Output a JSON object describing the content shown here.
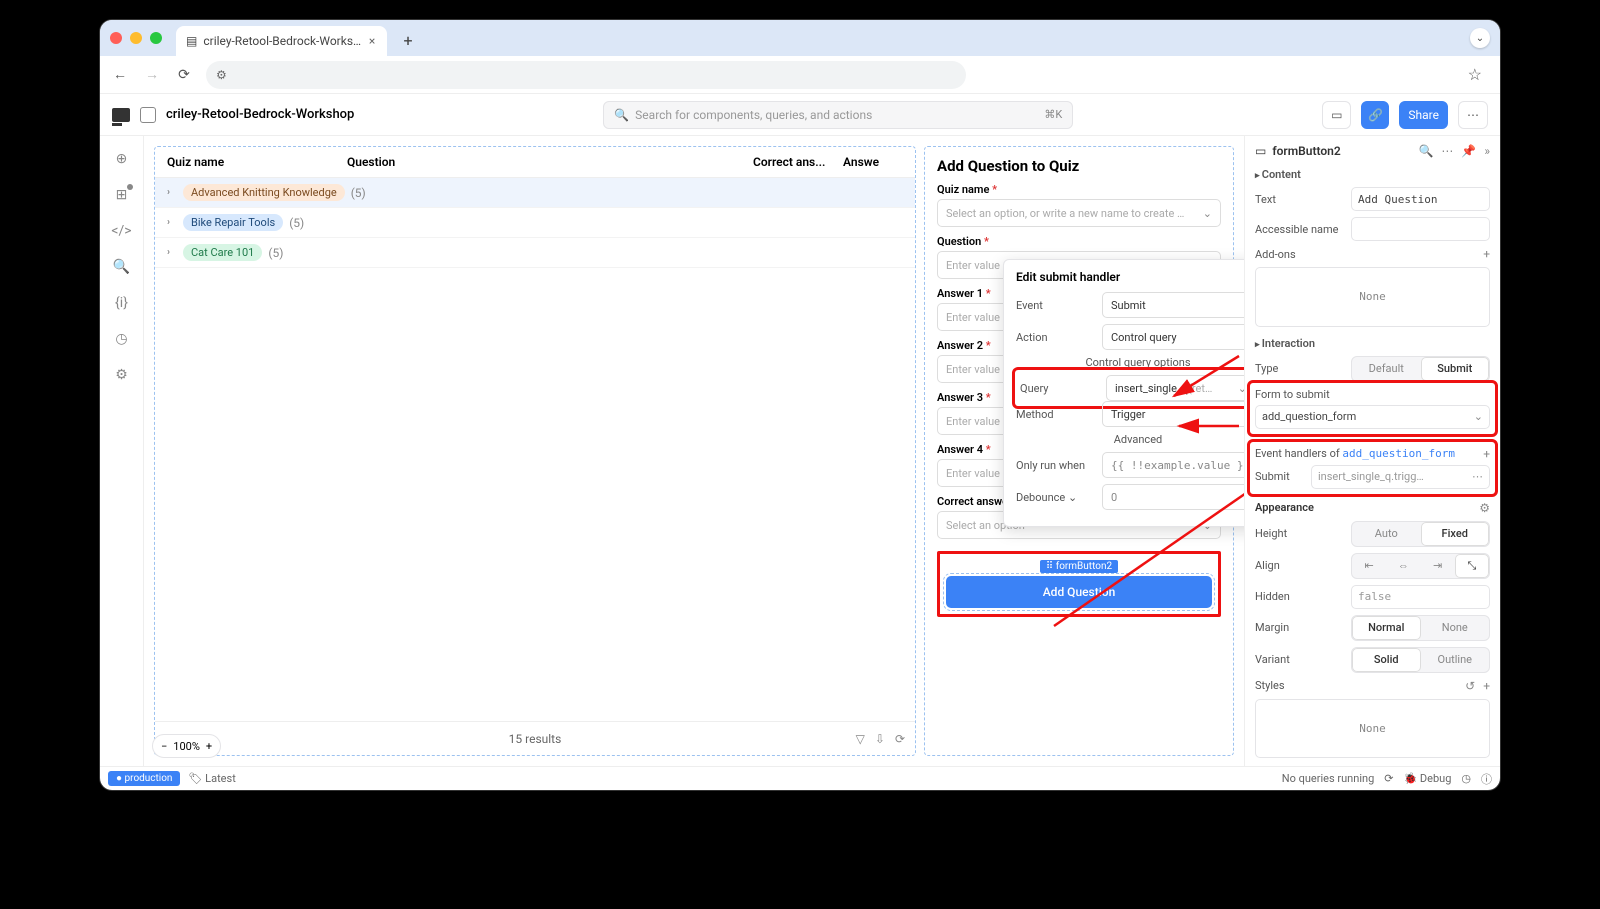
{
  "browser": {
    "tab_title": "criley-Retool-Bedrock-Works…",
    "shortcut": "⌘K"
  },
  "header": {
    "breadcrumb": "criley-Retool-Bedrock-Workshop",
    "search_placeholder": "Search for components, queries, and actions",
    "share": "Share"
  },
  "table": {
    "cols": {
      "c1": "Quiz name",
      "c2": "Question",
      "c3": "Correct ans...",
      "c4": "Answe"
    },
    "rows": [
      {
        "name": "Advanced Knitting Knowledge",
        "count": "(5)",
        "pill": "o"
      },
      {
        "name": "Bike Repair Tools",
        "count": "(5)",
        "pill": "b"
      },
      {
        "name": "Cat Care 101",
        "count": "(5)",
        "pill": "g"
      }
    ],
    "results": "15 results"
  },
  "form": {
    "title": "Add Question to Quiz",
    "quiz_label": "Quiz name",
    "quiz_ph": "Select an option, or write a new name to create …",
    "question_label": "Question",
    "enter_ph": "Enter value",
    "a1": "Answer 1",
    "a2": "Answer 2",
    "a3": "Answer 3",
    "a4": "Answer 4",
    "correct": "Correct answer",
    "select_ph": "Select an option",
    "comp_tag": "formButton2",
    "btn": "Add Question"
  },
  "popover": {
    "title": "Edit submit handler",
    "event_l": "Event",
    "event_v": "Submit",
    "action_l": "Action",
    "action_v": "Control query",
    "opts": "Control query options",
    "query_l": "Query",
    "query_v": "insert_single_q",
    "query_t": " (ret…",
    "method_l": "Method",
    "method_v": "Trigger",
    "advanced": "Advanced",
    "only_l": "Only run when",
    "only_v": "{{ !!example.value }}",
    "deb_l": "Debounce",
    "deb_v": "0"
  },
  "inspector": {
    "name": "formButton2",
    "content": "Content",
    "text_l": "Text",
    "text_v": "Add Question",
    "acc_l": "Accessible name",
    "addons_l": "Add-ons",
    "none": "None",
    "interaction": "Interaction",
    "type_l": "Type",
    "type_a": "Default",
    "type_b": "Submit",
    "form_l": "Form to submit",
    "form_v": "add_question_form",
    "eh_l": "Event handlers of ",
    "eh_link": "add_question_form",
    "submit_l": "Submit",
    "submit_v": "insert_single_q.trigg…",
    "appearance": "Appearance",
    "height_l": "Height",
    "h_a": "Auto",
    "h_b": "Fixed",
    "align_l": "Align",
    "hidden_l": "Hidden",
    "hidden_v": "false",
    "margin_l": "Margin",
    "m_a": "Normal",
    "m_b": "None",
    "variant_l": "Variant",
    "v_a": "Solid",
    "v_b": "Outline",
    "styles_l": "Styles"
  },
  "footer": {
    "prod": "production",
    "latest": "Latest",
    "queries": "No queries running",
    "debug": "Debug"
  },
  "zoom": "100%"
}
